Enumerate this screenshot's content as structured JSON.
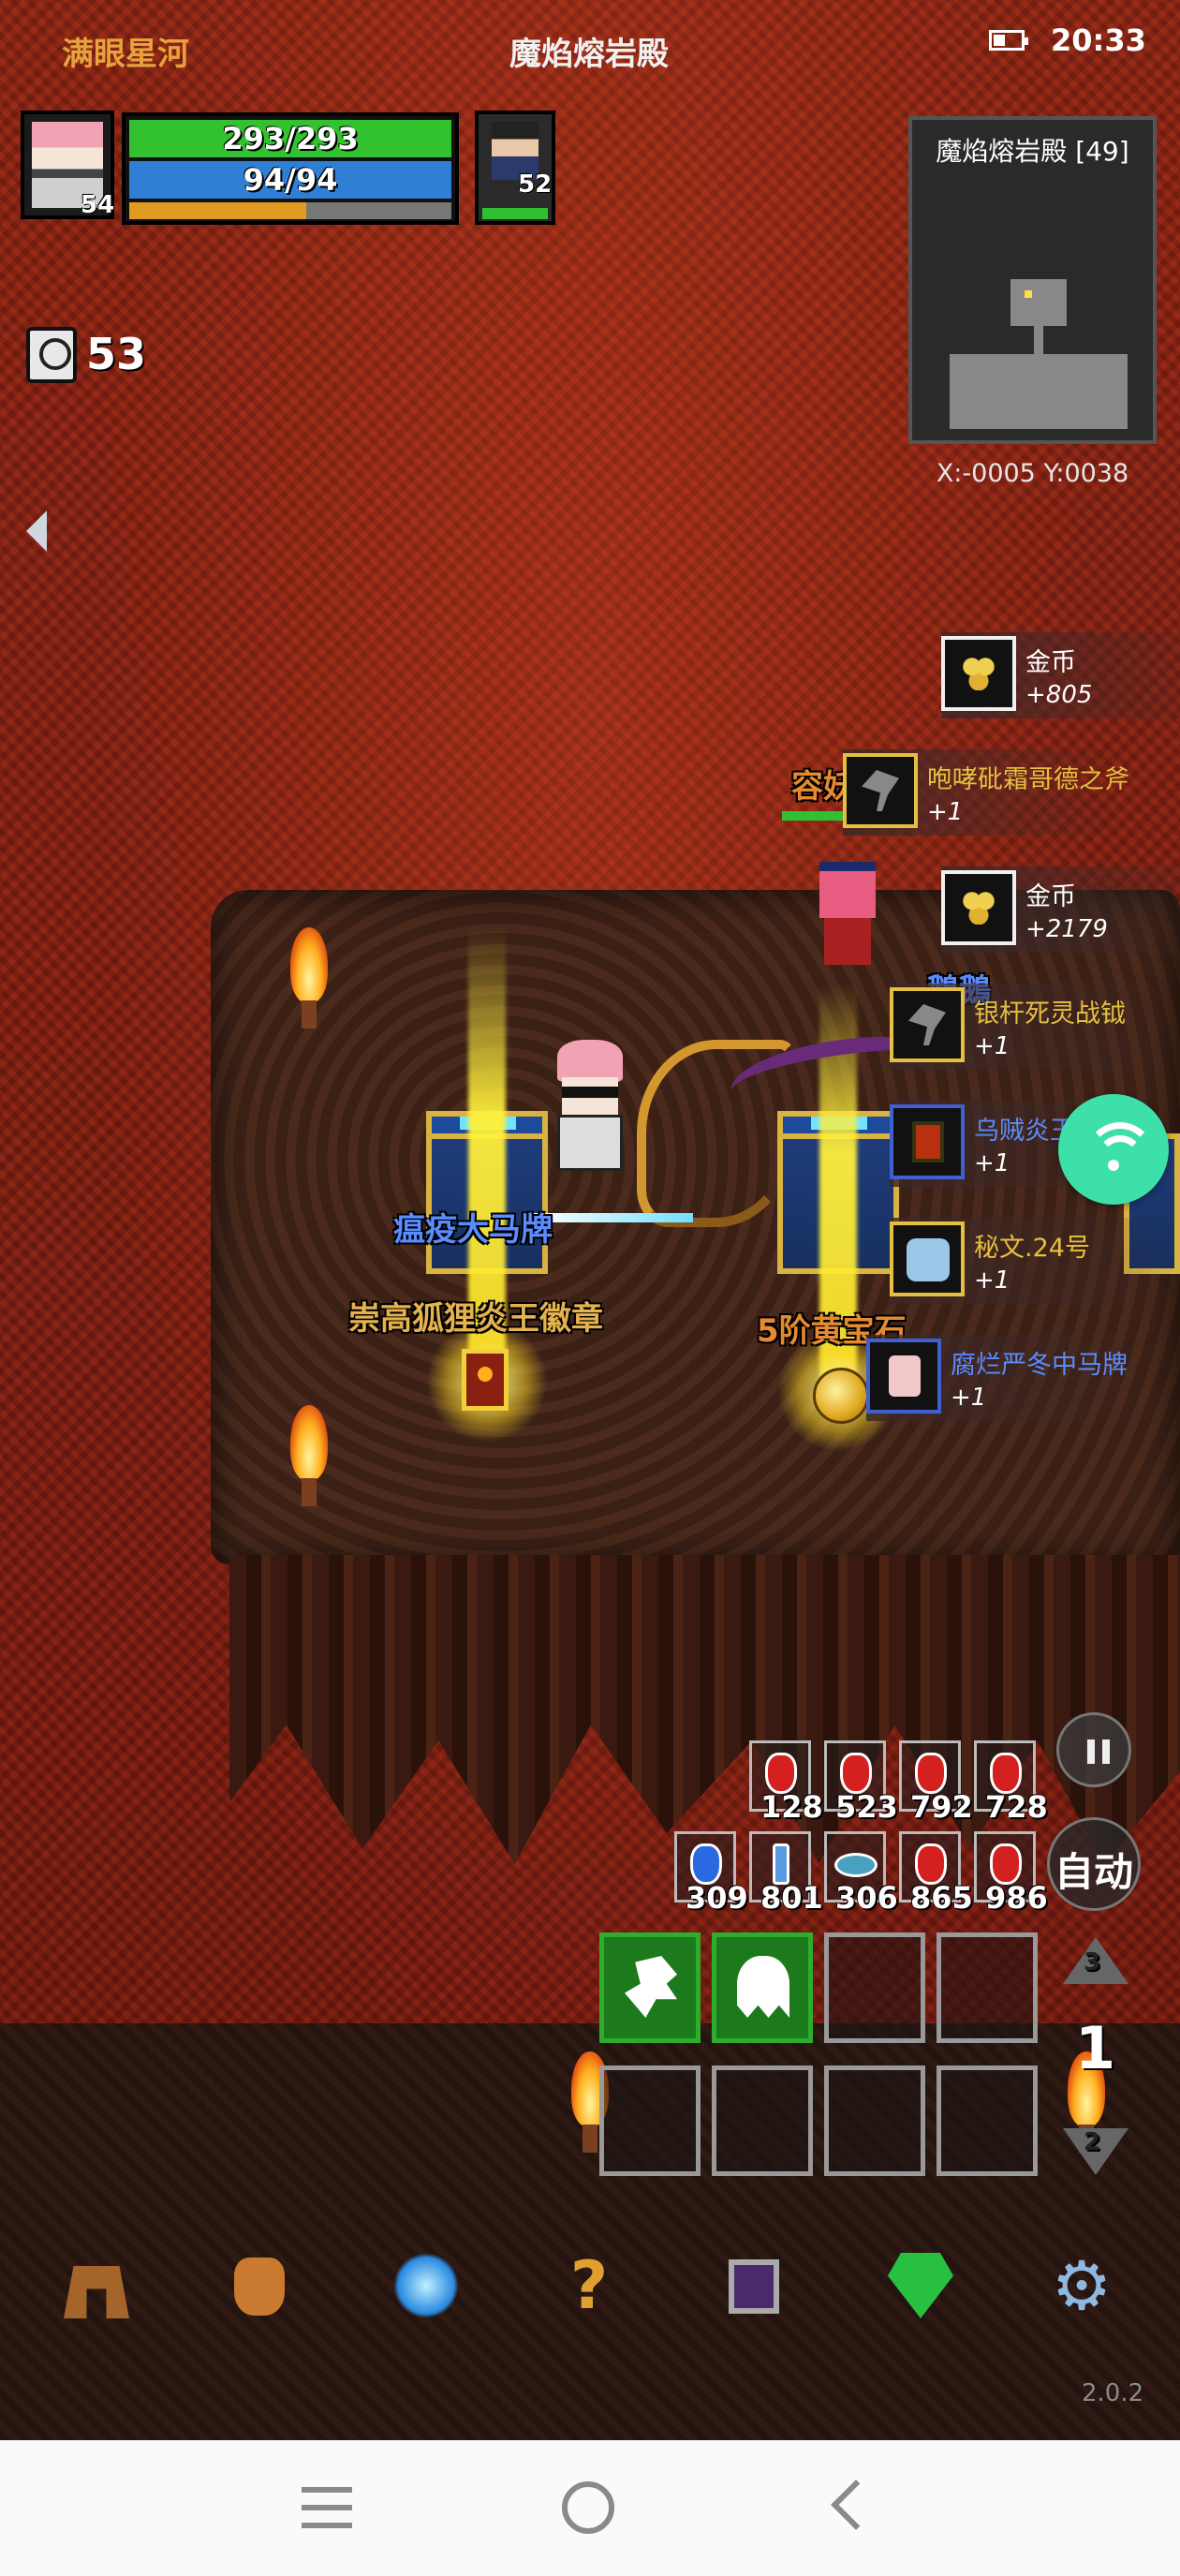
{
  "status_bar": {
    "player_name": "满眼星河",
    "location": "魔焰熔岩殿",
    "time": "20:33",
    "battery_icon": "battery-icon"
  },
  "player": {
    "level": "54",
    "hp": "293/293",
    "mp": "94/94",
    "exp_fraction": 0.55,
    "colors": {
      "hp": "#33c22f",
      "mp": "#2f7fd6",
      "exp": "#e09a20"
    }
  },
  "pet": {
    "level": "52",
    "hp_fraction": 1.0
  },
  "minimap": {
    "title": "魔焰熔岩殿 [49]",
    "coords": "X:-0005 Y:0038"
  },
  "timer": {
    "value": "53",
    "icon": "clock-icon"
  },
  "loot_feed": [
    {
      "name": "金币",
      "count": "+805",
      "icon": "gold-coins-icon",
      "color": "#ffffff"
    },
    {
      "name": "咆哮砒霜哥德之斧",
      "count": "+1",
      "icon": "axe-icon",
      "color": "#e5c040"
    },
    {
      "name": "金币",
      "count": "+2179",
      "icon": "gold-coins-icon",
      "color": "#ffffff"
    },
    {
      "name": "银杆死灵战钺",
      "count": "+1",
      "icon": "halberd-icon",
      "color": "#e5c040"
    },
    {
      "name": "乌贼炎王",
      "count": "+1",
      "icon": "armor-icon",
      "color": "#5a8cff"
    },
    {
      "name": "秘文.24号",
      "count": "+1",
      "icon": "rune-scroll-icon",
      "color": "#e5c040"
    },
    {
      "name": "腐烂严冬中马牌",
      "count": "+1",
      "icon": "badge-icon",
      "color": "#5a8cff"
    }
  ],
  "ground_labels": {
    "item_blue": "瘟疫大马牌",
    "item_gold": "崇高狐狸炎王徽章",
    "item_orange": "5阶黄宝石",
    "enemy_name": "容妖",
    "enemy_name2": "鵝鵝"
  },
  "consumables": {
    "row1": [
      {
        "icon": "red-potion-icon",
        "count": "128"
      },
      {
        "icon": "red-potion-icon",
        "count": "523"
      },
      {
        "icon": "red-potion-icon",
        "count": "792"
      },
      {
        "icon": "red-potion-icon",
        "count": "728"
      }
    ],
    "row2": [
      {
        "icon": "blue-potion-icon",
        "count": "309"
      },
      {
        "icon": "vial-icon",
        "count": "801"
      },
      {
        "icon": "fish-icon",
        "count": "306"
      },
      {
        "icon": "red-potion-icon",
        "count": "865"
      },
      {
        "icon": "red-potion-icon",
        "count": "986"
      }
    ]
  },
  "controls": {
    "pause_icon": "pause-icon",
    "auto_label": "自动",
    "page_up_num": "3",
    "page_current": "1",
    "page_down_num": "2"
  },
  "skills": [
    {
      "icon": "horse-skill-icon",
      "active": true
    },
    {
      "icon": "ghost-skill-icon",
      "active": true
    },
    {
      "icon": "empty-slot",
      "active": false
    },
    {
      "icon": "empty-slot",
      "active": false
    },
    {
      "icon": "empty-slot",
      "active": false
    },
    {
      "icon": "empty-slot",
      "active": false
    },
    {
      "icon": "empty-slot",
      "active": false
    },
    {
      "icon": "empty-slot",
      "active": false
    }
  ],
  "bottom_menu": [
    {
      "icon": "helmet-icon"
    },
    {
      "icon": "bag-icon"
    },
    {
      "icon": "skill-orb-icon"
    },
    {
      "icon": "help-icon",
      "glyph": "?"
    },
    {
      "icon": "spellbook-icon"
    },
    {
      "icon": "gem-icon"
    },
    {
      "icon": "gear-icon",
      "glyph": "⚙"
    }
  ],
  "version": "2.0.2"
}
